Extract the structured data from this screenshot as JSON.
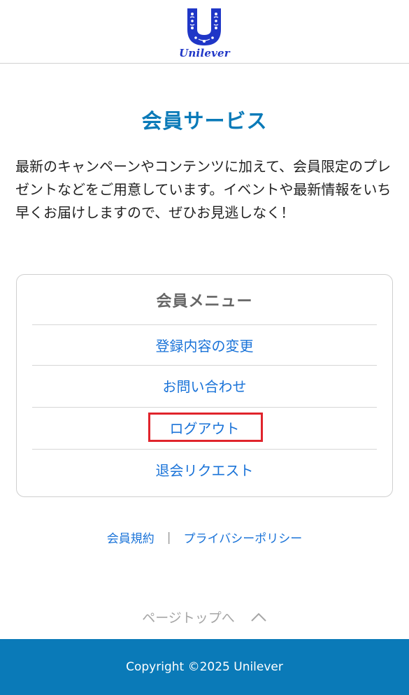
{
  "header": {
    "logo_text": "Unilever"
  },
  "page_title": "会員サービス",
  "intro": "最新のキャンペーンやコンテンツに加えて、会員限定のプレゼントなどをご用意しています。イベントや最新情報をいち早くお届けしますので、ぜひお見逃しなく！",
  "member_menu": {
    "heading": "会員メニュー",
    "items": [
      {
        "label": "登録内容の変更"
      },
      {
        "label": "お問い合わせ"
      },
      {
        "label": "ログアウト"
      },
      {
        "label": "退会リクエスト"
      }
    ]
  },
  "footer": {
    "links": [
      {
        "label": "会員規約"
      },
      {
        "label": "プライバシーポリシー"
      }
    ],
    "separator": "|",
    "page_top_label": "ページトップへ",
    "copyright": "Copyright ©2025 Unilever"
  },
  "colors": {
    "brand_blue": "#0a7ab8",
    "link_blue": "#1a73d8",
    "logo_blue": "#1f36c7",
    "highlight_red": "#e0242c"
  }
}
